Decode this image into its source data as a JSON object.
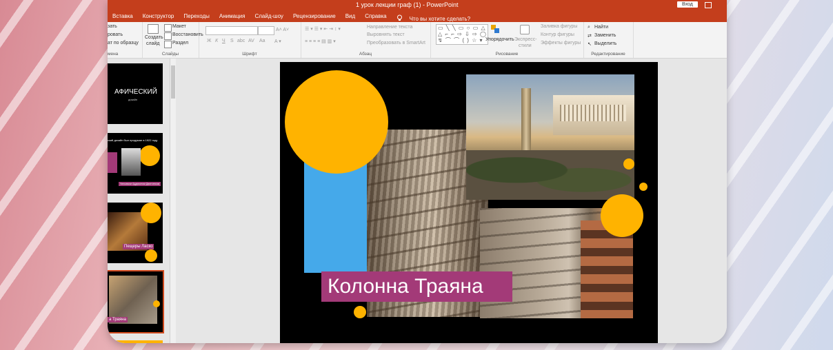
{
  "window": {
    "title": "1 урок лекции граф  (1)  -  PowerPoint",
    "signin": "Вход"
  },
  "tabs": [
    "Вставка",
    "Конструктор",
    "Переходы",
    "Анимация",
    "Слайд-шоу",
    "Рецензирование",
    "Вид",
    "Справка"
  ],
  "tellme": "Что вы хотите сделать?",
  "ribbon": {
    "clipboard": {
      "paste": "зать",
      "copy": "ровать",
      "format_painter": "ат по образцу",
      "label": "мена"
    },
    "slides": {
      "new_slide": "Создать",
      "new_slide2": "слайд",
      "layout": "Макет",
      "reset": "Восстановить",
      "section": "Раздел",
      "label": "Слайды"
    },
    "font": {
      "label": "Шрифт",
      "bold": "Ж",
      "italic": "К",
      "underline": "Ч",
      "shadow": "S",
      "strike": "abc",
      "spacing": "AV",
      "case": "Aa"
    },
    "paragraph": {
      "text_direction": "Направление текста",
      "align_text": "Выровнять текст",
      "smartart": "Преобразовать в SmartArt",
      "label": "Абзац"
    },
    "drawing": {
      "arrange": "Упорядочить",
      "quick_styles": "Экспресс-",
      "quick_styles2": "стили",
      "fill": "Заливка фигуры",
      "outline": "Контур фигуры",
      "effects": "Эффекты фигуры",
      "label": "Рисование"
    },
    "editing": {
      "find": "Найти",
      "replace": "Заменить",
      "select": "Выделить",
      "label": "Редактирование"
    }
  },
  "thumbnails": {
    "t1_title": "АФИЧЕСКИЙ",
    "t1_sub": "дизайн",
    "t2_text": "ский дизайн был придуман  в 1922 году",
    "t2_caption": "Уильямом Аддисоном Двиггинсом",
    "t3_caption": "Пещеры Ласко",
    "t4_caption": "а Траяна"
  },
  "slide": {
    "caption": "Колонна Траяна"
  },
  "colors": {
    "titlebar": "#c43e1c",
    "accent_yellow": "#ffb300",
    "caption_bg": "#a33a78",
    "blue_block": "#45a9ea"
  }
}
